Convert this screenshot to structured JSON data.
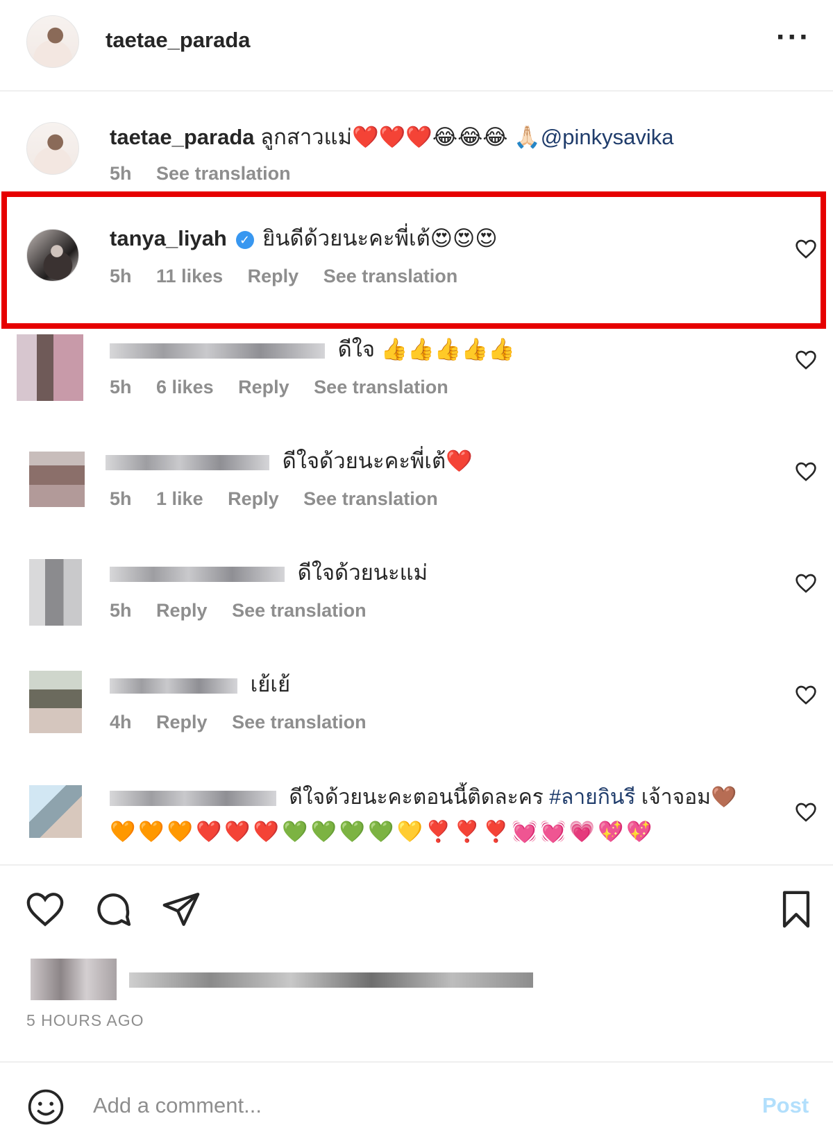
{
  "header": {
    "username": "taetae_parada",
    "more_icon": "more-horizontal-icon"
  },
  "caption": {
    "username": "taetae_parada",
    "text": "ลูกสาวแม่❤️❤️❤️😂😂😂 🙏🏻",
    "mention": "@pinkysavika",
    "time": "5h",
    "see_translation": "See translation"
  },
  "comments": [
    {
      "username": "tanya_liyah",
      "verified": true,
      "text": "ยินดีด้วยนะคะพี่เต้😍😍😍",
      "time": "5h",
      "likes": "11 likes",
      "reply": "Reply",
      "see_translation": "See translation"
    },
    {
      "text": "ดีใจ 👍👍👍👍👍",
      "time": "5h",
      "likes": "6 likes",
      "reply": "Reply",
      "see_translation": "See translation"
    },
    {
      "text": "ดีใจด้วยนะคะพี่เต้❤️",
      "time": "5h",
      "likes": "1 like",
      "reply": "Reply",
      "see_translation": "See translation"
    },
    {
      "text": "ดีใจด้วยนะแม่",
      "time": "5h",
      "reply": "Reply",
      "see_translation": "See translation"
    },
    {
      "text": "เย้เย้",
      "time": "4h",
      "reply": "Reply",
      "see_translation": "See translation"
    },
    {
      "text": "ดีใจด้วยนะคะตอนนี้ติดละคร",
      "hashtag": "#ลายกินรี",
      "text_after": "เจ้าจอม🤎",
      "emoji_line": "🧡🧡🧡❤️❤️❤️💚💚💚💚💛❣️❣️❣️💓💓💗💖💖"
    }
  ],
  "footer": {
    "time_ago": "5 HOURS AGO",
    "add_comment_placeholder": "Add a comment...",
    "post_label": "Post"
  },
  "colors": {
    "highlight": "#e60000",
    "link": "#1f3c6b",
    "muted": "#8e8e8e",
    "post_disabled": "#b2dffc"
  }
}
